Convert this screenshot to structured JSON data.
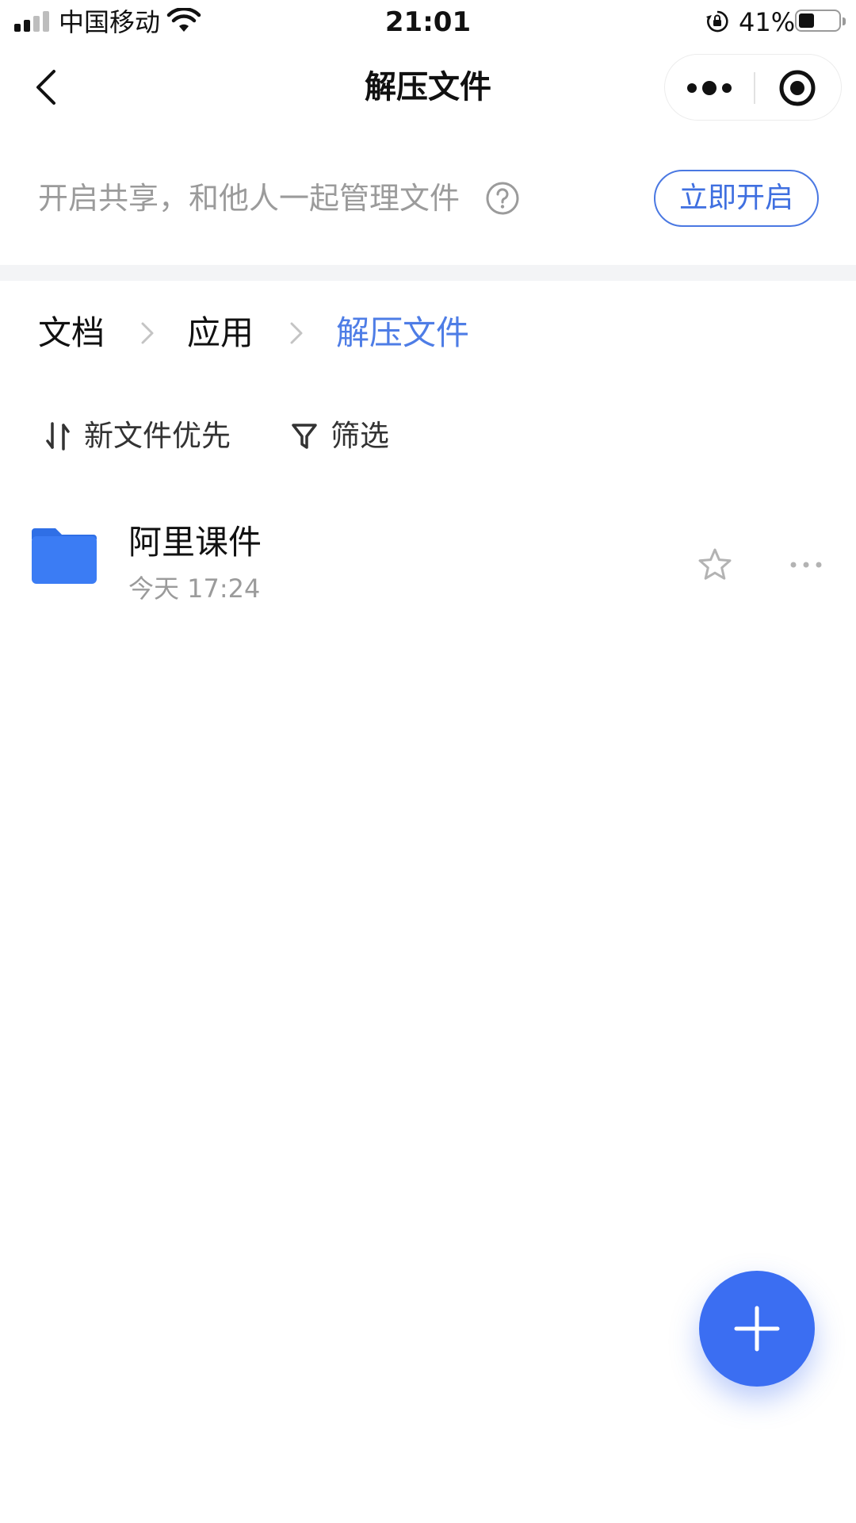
{
  "status_bar": {
    "carrier": "中国移动",
    "time": "21:01",
    "battery_percent": "41%",
    "battery_level": 0.41
  },
  "nav": {
    "title": "解压文件"
  },
  "share_banner": {
    "text": "开启共享，和他人一起管理文件",
    "button_label": "立即开启"
  },
  "breadcrumb": {
    "items": [
      "文档",
      "应用",
      "解压文件"
    ]
  },
  "toolbar": {
    "sort_label": "新文件优先",
    "filter_label": "筛选"
  },
  "files": [
    {
      "name": "阿里课件",
      "time": "今天 17:24"
    }
  ],
  "colors": {
    "accent": "#4e7de6",
    "fab": "#3b6ef2",
    "folder": "#3b7cf4"
  },
  "icons": {
    "back": "back-arrow-icon",
    "capsule_more": "more-dots-icon",
    "capsule_close": "target-circle-icon",
    "help": "question-circle-icon",
    "sort": "sort-arrows-icon",
    "filter": "funnel-icon",
    "folder": "folder-icon",
    "star": "star-outline-icon",
    "row_more": "ellipsis-icon",
    "fab": "plus-icon"
  }
}
